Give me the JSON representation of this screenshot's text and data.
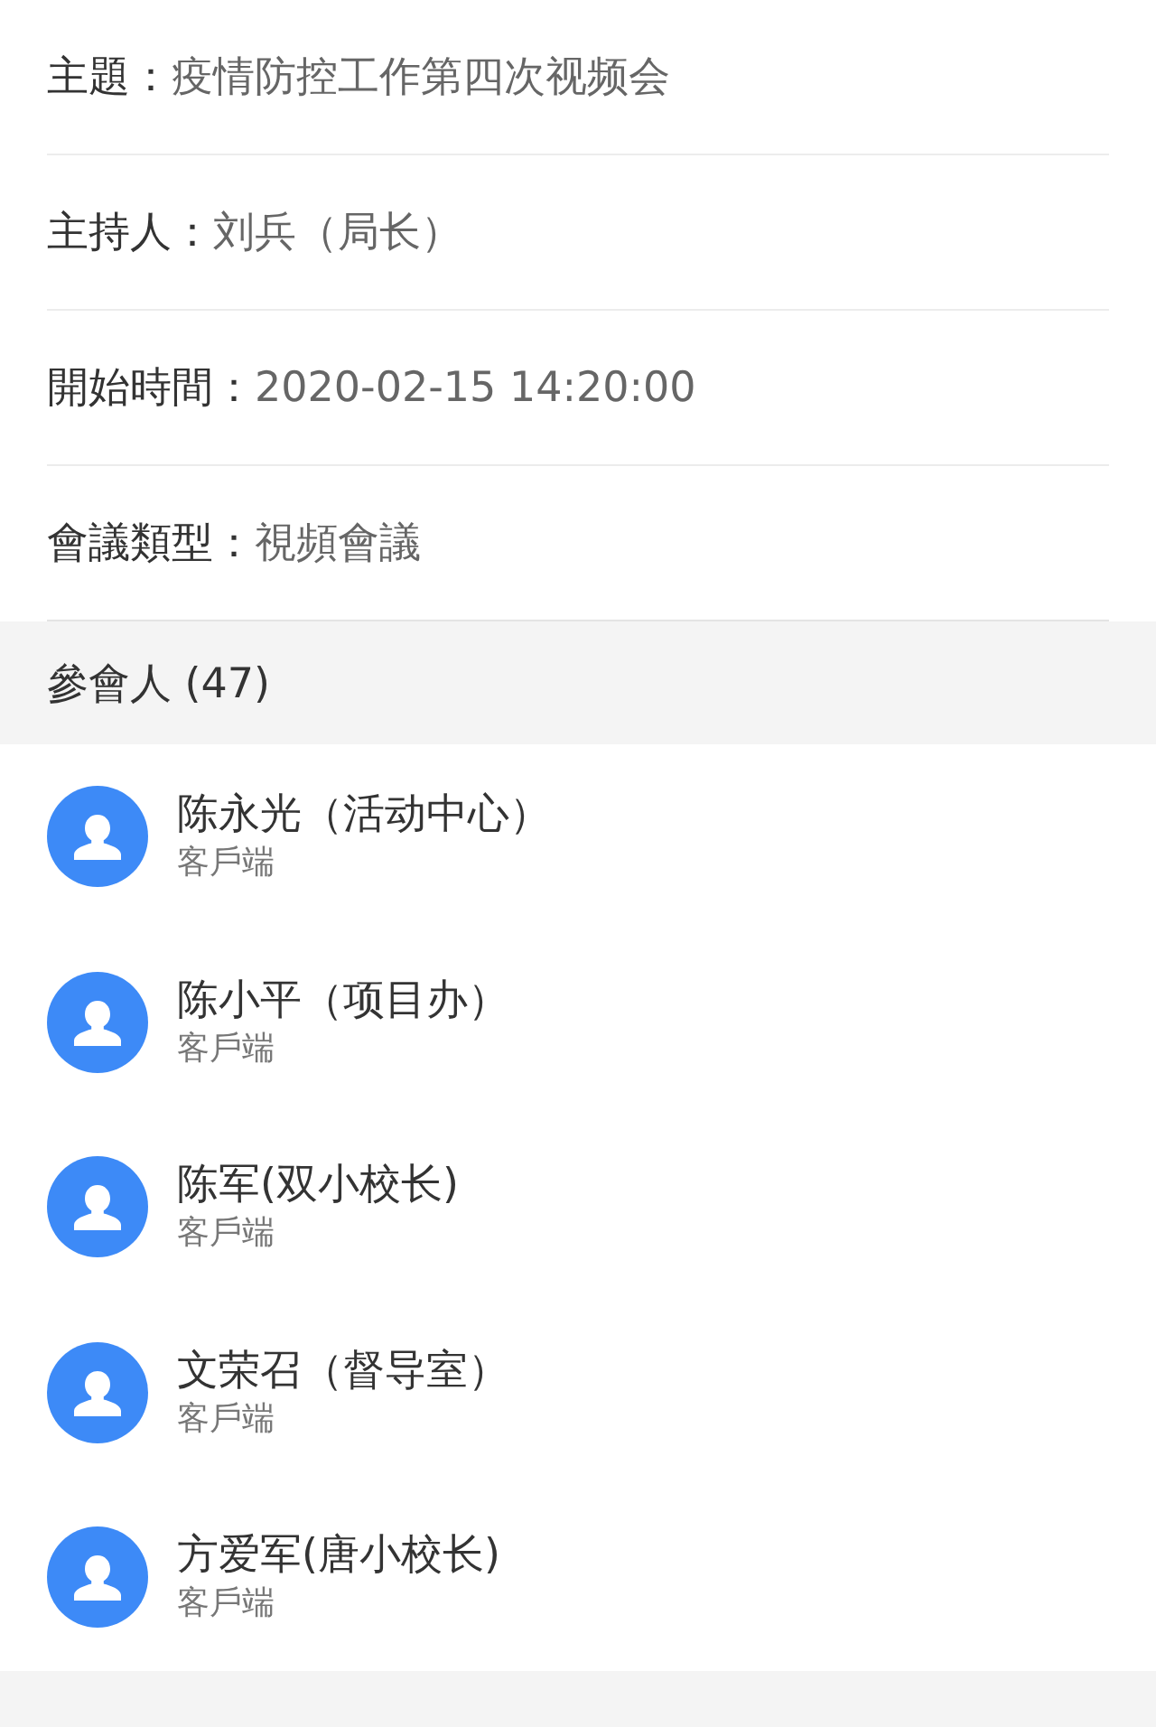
{
  "details": [
    {
      "label": "主題：",
      "value": "疫情防控工作第四次视频会"
    },
    {
      "label": "主持人：",
      "value": "刘兵（局长）"
    },
    {
      "label": "開始時間：",
      "value": "2020-02-15 14:20:00"
    },
    {
      "label": "會議類型：",
      "value": "視頻會議"
    }
  ],
  "participants_header": "參會人 (47)",
  "participants": [
    {
      "name": "陈永光（活动中心）",
      "client": "客戶端"
    },
    {
      "name": "陈小平（项目办）",
      "client": "客戶端"
    },
    {
      "name": "陈军(双小校长)",
      "client": "客戶端"
    },
    {
      "name": "文荣召（督导室）",
      "client": "客戶端"
    },
    {
      "name": "方爱军(唐小校长)",
      "client": "客戶端"
    }
  ]
}
